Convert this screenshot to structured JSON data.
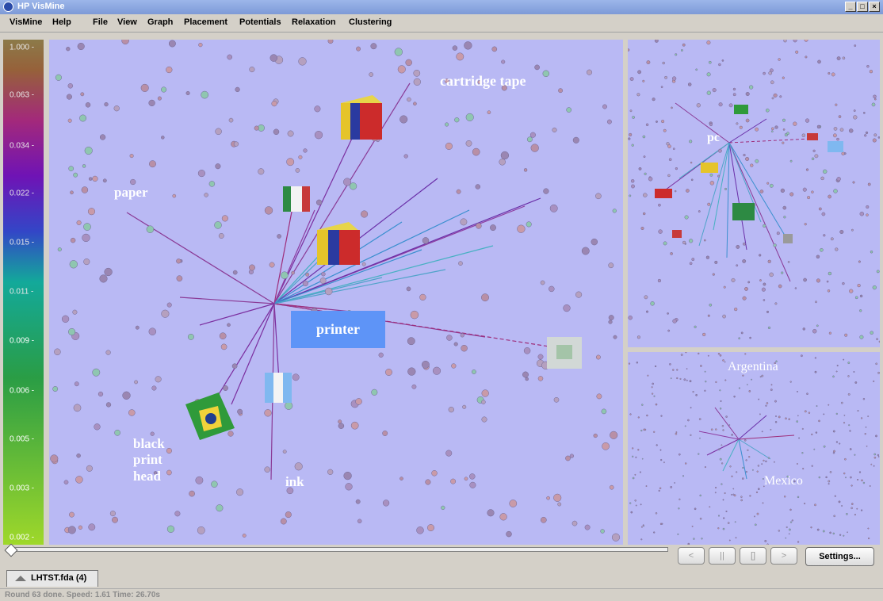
{
  "window": {
    "title": "HP VisMine",
    "controls": [
      "_",
      "□",
      "×"
    ]
  },
  "menus": [
    {
      "label": "VisMine"
    },
    {
      "label": "Help"
    },
    {
      "label": "File"
    },
    {
      "label": "View"
    },
    {
      "label": "Graph"
    },
    {
      "label": "Placement"
    },
    {
      "label": "Potentials"
    },
    {
      "label": "Relaxation"
    },
    {
      "label": "Clustering"
    }
  ],
  "legend": {
    "ticks": [
      "1.000 -",
      "0.063 -",
      "0.034 -",
      "0.022 -",
      "0.015 -",
      "0.011 -",
      "0.009 -",
      "0.006 -",
      "0.005 -",
      "0.003 -",
      "0.002 -"
    ],
    "colors": {
      "top": "#8c7a49",
      "mid": "#3346c7",
      "bottom": "#9fd82a"
    }
  },
  "main_view": {
    "labels": {
      "cartridge": "cartridge tape",
      "paper": "paper",
      "printer": "printer",
      "black_print_head": [
        "black",
        "print",
        "head"
      ],
      "ink": "ink"
    },
    "colors": {
      "background": "#b9b9f4",
      "selected_label_bg": "#5e94f7"
    }
  },
  "side_top": {
    "label": "pc"
  },
  "side_bottom": {
    "labels": {
      "argentina": "Argentina",
      "mexico": "Mexico"
    }
  },
  "controls": {
    "prev": "<",
    "pause": "||",
    "stop": "[]",
    "next": ">",
    "settings": "Settings..."
  },
  "tab": {
    "label": "LHTST.fda (4)"
  },
  "status": {
    "text": "Round 63 done. Speed: 1.61 Time: 26.70s"
  }
}
